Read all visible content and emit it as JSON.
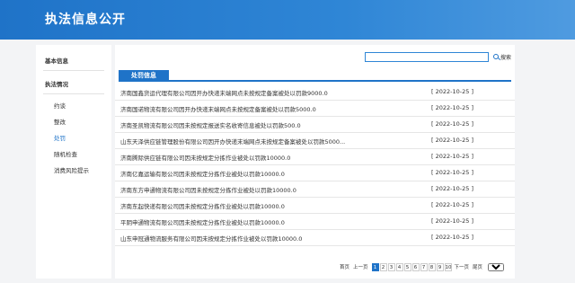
{
  "header": {
    "title": "执法信息公开"
  },
  "sidebar": {
    "section1": "基本信息",
    "section2": "执法情况",
    "items": [
      {
        "label": "约谈"
      },
      {
        "label": "整改"
      },
      {
        "label": "处罚"
      },
      {
        "label": "随机检查"
      },
      {
        "label": "消费风险提示"
      }
    ]
  },
  "search": {
    "button_label": "搜索",
    "value": ""
  },
  "tab": {
    "label": "处罚信息"
  },
  "records": [
    {
      "title": "济南国鑫货运代理有限公司因开办快递末端网点未按规定备案被处以罚款9000.0",
      "date": "[ 2022-10-25 ]"
    },
    {
      "title": "济南国诺物流有限公司因开办快递末端网点未按规定备案被处以罚款5000.0",
      "date": "[ 2022-10-25 ]"
    },
    {
      "title": "济南圣凯物流有限公司因未按规定报送实名收寄信息被处以罚款500.0",
      "date": "[ 2022-10-25 ]"
    },
    {
      "title": "山东天泽供应链管理股份有限公司因开办快递末端网点未按规定备案被处以罚款5000...",
      "date": "[ 2022-10-25 ]"
    },
    {
      "title": "济南腾际供应链有限公司因未按规定分拣作业被处以罚款10000.0",
      "date": "[ 2022-10-25 ]"
    },
    {
      "title": "济南亿嘉运输有限公司因未按规定分拣作业被处以罚款10000.0",
      "date": "[ 2022-10-25 ]"
    },
    {
      "title": "济南东方申通物流有限公司因未按规定分拣作业被处以罚款10000.0",
      "date": "[ 2022-10-25 ]"
    },
    {
      "title": "济南东起快递有限公司因未按规定分拣作业被处以罚款10000.0",
      "date": "[ 2022-10-25 ]"
    },
    {
      "title": "平阴申通物流有限公司因未按规定分拣作业被处以罚款10000.0",
      "date": "[ 2022-10-25 ]"
    },
    {
      "title": "山东申冠通物流服务有限公司因未按规定分拣作业被处以罚款10000.0",
      "date": "[ 2022-10-25 ]"
    }
  ],
  "pager": {
    "first": "首页",
    "prev": "上一页",
    "pages": [
      "1",
      "2",
      "3",
      "4",
      "5",
      "6",
      "7",
      "8",
      "9",
      "10"
    ],
    "current": "1",
    "next": "下一页",
    "last": "尾页",
    "select_value": "1"
  }
}
